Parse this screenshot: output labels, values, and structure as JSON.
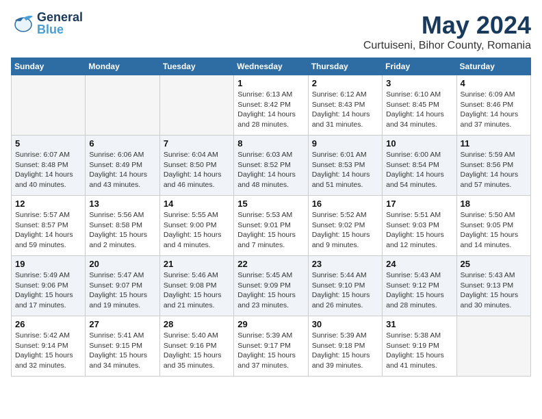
{
  "header": {
    "logo_general": "General",
    "logo_blue": "Blue",
    "month_year": "May 2024",
    "location": "Curtuiseni, Bihor County, Romania"
  },
  "days_of_week": [
    "Sunday",
    "Monday",
    "Tuesday",
    "Wednesday",
    "Thursday",
    "Friday",
    "Saturday"
  ],
  "weeks": [
    [
      {
        "day": "",
        "info": ""
      },
      {
        "day": "",
        "info": ""
      },
      {
        "day": "",
        "info": ""
      },
      {
        "day": "1",
        "info": "Sunrise: 6:13 AM\nSunset: 8:42 PM\nDaylight: 14 hours\nand 28 minutes."
      },
      {
        "day": "2",
        "info": "Sunrise: 6:12 AM\nSunset: 8:43 PM\nDaylight: 14 hours\nand 31 minutes."
      },
      {
        "day": "3",
        "info": "Sunrise: 6:10 AM\nSunset: 8:45 PM\nDaylight: 14 hours\nand 34 minutes."
      },
      {
        "day": "4",
        "info": "Sunrise: 6:09 AM\nSunset: 8:46 PM\nDaylight: 14 hours\nand 37 minutes."
      }
    ],
    [
      {
        "day": "5",
        "info": "Sunrise: 6:07 AM\nSunset: 8:48 PM\nDaylight: 14 hours\nand 40 minutes."
      },
      {
        "day": "6",
        "info": "Sunrise: 6:06 AM\nSunset: 8:49 PM\nDaylight: 14 hours\nand 43 minutes."
      },
      {
        "day": "7",
        "info": "Sunrise: 6:04 AM\nSunset: 8:50 PM\nDaylight: 14 hours\nand 46 minutes."
      },
      {
        "day": "8",
        "info": "Sunrise: 6:03 AM\nSunset: 8:52 PM\nDaylight: 14 hours\nand 48 minutes."
      },
      {
        "day": "9",
        "info": "Sunrise: 6:01 AM\nSunset: 8:53 PM\nDaylight: 14 hours\nand 51 minutes."
      },
      {
        "day": "10",
        "info": "Sunrise: 6:00 AM\nSunset: 8:54 PM\nDaylight: 14 hours\nand 54 minutes."
      },
      {
        "day": "11",
        "info": "Sunrise: 5:59 AM\nSunset: 8:56 PM\nDaylight: 14 hours\nand 57 minutes."
      }
    ],
    [
      {
        "day": "12",
        "info": "Sunrise: 5:57 AM\nSunset: 8:57 PM\nDaylight: 14 hours\nand 59 minutes."
      },
      {
        "day": "13",
        "info": "Sunrise: 5:56 AM\nSunset: 8:58 PM\nDaylight: 15 hours\nand 2 minutes."
      },
      {
        "day": "14",
        "info": "Sunrise: 5:55 AM\nSunset: 9:00 PM\nDaylight: 15 hours\nand 4 minutes."
      },
      {
        "day": "15",
        "info": "Sunrise: 5:53 AM\nSunset: 9:01 PM\nDaylight: 15 hours\nand 7 minutes."
      },
      {
        "day": "16",
        "info": "Sunrise: 5:52 AM\nSunset: 9:02 PM\nDaylight: 15 hours\nand 9 minutes."
      },
      {
        "day": "17",
        "info": "Sunrise: 5:51 AM\nSunset: 9:03 PM\nDaylight: 15 hours\nand 12 minutes."
      },
      {
        "day": "18",
        "info": "Sunrise: 5:50 AM\nSunset: 9:05 PM\nDaylight: 15 hours\nand 14 minutes."
      }
    ],
    [
      {
        "day": "19",
        "info": "Sunrise: 5:49 AM\nSunset: 9:06 PM\nDaylight: 15 hours\nand 17 minutes."
      },
      {
        "day": "20",
        "info": "Sunrise: 5:47 AM\nSunset: 9:07 PM\nDaylight: 15 hours\nand 19 minutes."
      },
      {
        "day": "21",
        "info": "Sunrise: 5:46 AM\nSunset: 9:08 PM\nDaylight: 15 hours\nand 21 minutes."
      },
      {
        "day": "22",
        "info": "Sunrise: 5:45 AM\nSunset: 9:09 PM\nDaylight: 15 hours\nand 23 minutes."
      },
      {
        "day": "23",
        "info": "Sunrise: 5:44 AM\nSunset: 9:10 PM\nDaylight: 15 hours\nand 26 minutes."
      },
      {
        "day": "24",
        "info": "Sunrise: 5:43 AM\nSunset: 9:12 PM\nDaylight: 15 hours\nand 28 minutes."
      },
      {
        "day": "25",
        "info": "Sunrise: 5:43 AM\nSunset: 9:13 PM\nDaylight: 15 hours\nand 30 minutes."
      }
    ],
    [
      {
        "day": "26",
        "info": "Sunrise: 5:42 AM\nSunset: 9:14 PM\nDaylight: 15 hours\nand 32 minutes."
      },
      {
        "day": "27",
        "info": "Sunrise: 5:41 AM\nSunset: 9:15 PM\nDaylight: 15 hours\nand 34 minutes."
      },
      {
        "day": "28",
        "info": "Sunrise: 5:40 AM\nSunset: 9:16 PM\nDaylight: 15 hours\nand 35 minutes."
      },
      {
        "day": "29",
        "info": "Sunrise: 5:39 AM\nSunset: 9:17 PM\nDaylight: 15 hours\nand 37 minutes."
      },
      {
        "day": "30",
        "info": "Sunrise: 5:39 AM\nSunset: 9:18 PM\nDaylight: 15 hours\nand 39 minutes."
      },
      {
        "day": "31",
        "info": "Sunrise: 5:38 AM\nSunset: 9:19 PM\nDaylight: 15 hours\nand 41 minutes."
      },
      {
        "day": "",
        "info": ""
      }
    ]
  ]
}
